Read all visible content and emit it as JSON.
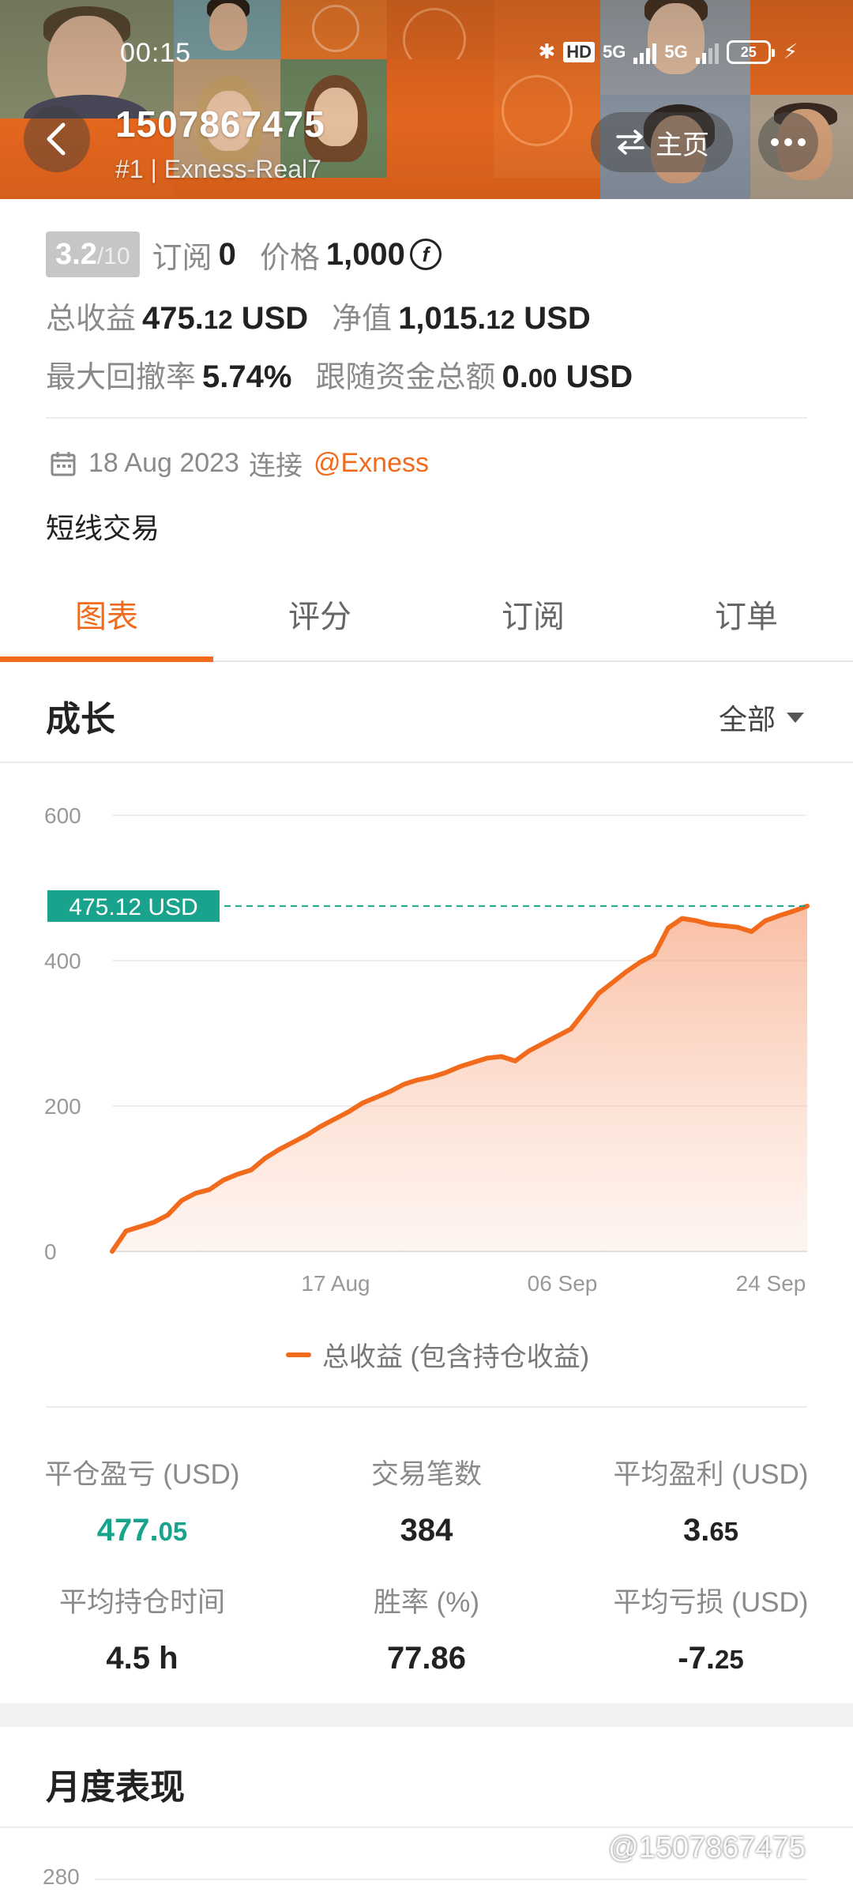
{
  "status_bar": {
    "time": "00:15",
    "battery": "25",
    "hd_label": "HD",
    "network_1": "5G",
    "network_2": "5G"
  },
  "header": {
    "account_id": "1507867475",
    "server": "#1 | Exness-Real7",
    "home_label": "主页"
  },
  "info": {
    "score": "3.2",
    "score_max": "/10",
    "subscribe_label": "订阅",
    "subscribe_count": "0",
    "price_label": "价格",
    "price_value": "1,000",
    "price_coin": "f",
    "total_profit_label": "总收益",
    "total_profit_main": "475.",
    "total_profit_decimal": "12",
    "total_profit_unit": "USD",
    "equity_label": "净值",
    "equity_main": "1,015.",
    "equity_decimal": "12",
    "equity_unit": "USD",
    "max_drawdown_label": "最大回撤率",
    "max_drawdown_value": "5.74%",
    "follow_funds_label": "跟随资金总额",
    "follow_funds_main": "0.",
    "follow_funds_decimal": "00",
    "follow_funds_unit": "USD",
    "connected_date": "18 Aug 2023",
    "connected_label": "连接",
    "broker": "@Exness",
    "strategy": "短线交易"
  },
  "tabs": [
    {
      "label": "图表",
      "active": true
    },
    {
      "label": "评分",
      "active": false
    },
    {
      "label": "订阅",
      "active": false
    },
    {
      "label": "订单",
      "active": false
    }
  ],
  "growth": {
    "title": "成长",
    "range": "全部"
  },
  "chart_data": {
    "type": "area",
    "title": "",
    "xlabel": "",
    "ylabel": "",
    "ylim": [
      0,
      600
    ],
    "yticks": [
      0,
      200,
      400,
      600
    ],
    "xticks": [
      "17 Aug",
      "06 Sep",
      "24 Sep"
    ],
    "current_value_label": "475.12 USD",
    "current_value": 475.12,
    "colors": {
      "line": "#f26a1b",
      "fill": "#fbd2bf",
      "marker": "#1aa38c"
    },
    "series": [
      {
        "name": "总收益 (包含持仓收益)",
        "values": [
          0,
          28,
          34,
          40,
          50,
          70,
          80,
          85,
          98,
          106,
          112,
          128,
          140,
          150,
          160,
          172,
          182,
          192,
          204,
          212,
          220,
          230,
          236,
          240,
          246,
          254,
          260,
          266,
          268,
          262,
          276,
          286,
          296,
          306,
          330,
          355,
          370,
          385,
          398,
          408,
          445,
          458,
          455,
          450,
          448,
          446,
          440,
          455,
          462,
          468,
          475.12
        ]
      }
    ]
  },
  "stats": [
    {
      "label": "平仓盈亏 (USD)",
      "main": "477.",
      "decimal": "05",
      "color": "#1aa38c"
    },
    {
      "label": "交易笔数",
      "main": "384",
      "decimal": "",
      "color": "#222222"
    },
    {
      "label": "平均盈利 (USD)",
      "main": "3.",
      "decimal": "65",
      "color": "#222222"
    },
    {
      "label": "平均持仓时间",
      "main": "4.5 h",
      "decimal": "",
      "color": "#222222"
    },
    {
      "label": "胜率 (%)",
      "main": "77.86",
      "decimal": "",
      "color": "#222222"
    },
    {
      "label": "平均亏损 (USD)",
      "main": "-7.",
      "decimal": "25",
      "color": "#222222"
    }
  ],
  "monthly": {
    "title": "月度表现",
    "first_tick": "280"
  },
  "watermark": "@1507867475",
  "accent_color": "#f26a1b"
}
